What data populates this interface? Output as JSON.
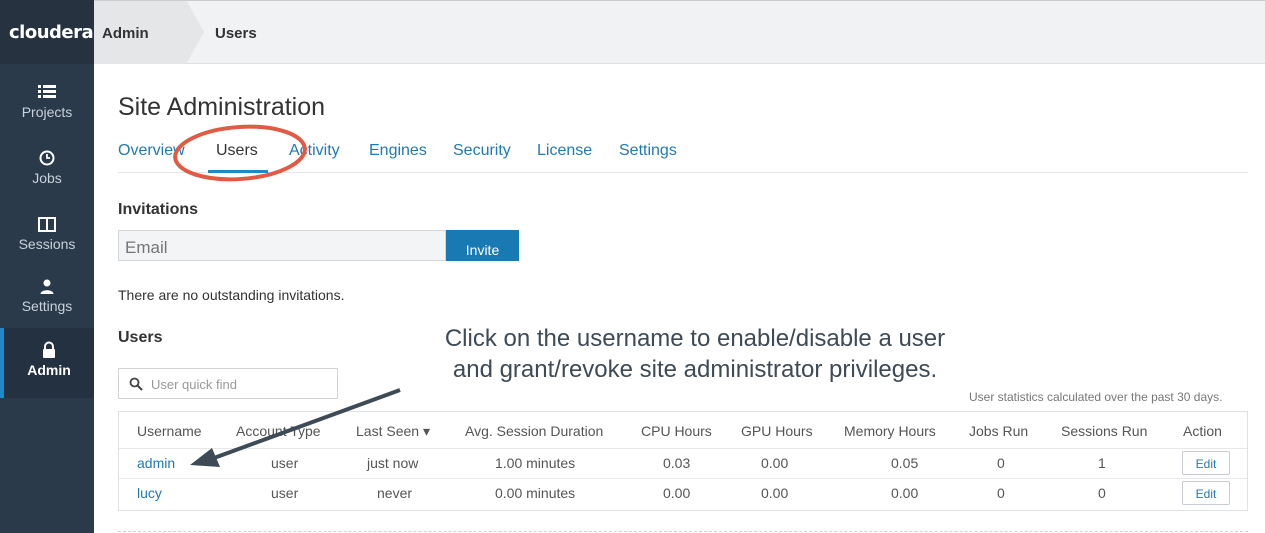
{
  "brand": {
    "logo_text": "cloudera"
  },
  "sidebar": {
    "items": [
      {
        "label": "Projects",
        "icon": "list-icon",
        "active": false
      },
      {
        "label": "Jobs",
        "icon": "clock-icon",
        "active": false
      },
      {
        "label": "Sessions",
        "icon": "columns-icon",
        "active": false
      },
      {
        "label": "Settings",
        "icon": "user-icon",
        "active": false
      },
      {
        "label": "Admin",
        "icon": "lock-icon",
        "active": true
      }
    ]
  },
  "breadcrumb": {
    "items": [
      "Admin",
      "Users"
    ]
  },
  "page": {
    "title": "Site Administration",
    "tabs": [
      "Overview",
      "Users",
      "Activity",
      "Engines",
      "Security",
      "License",
      "Settings"
    ],
    "active_tab": "Users"
  },
  "invitations": {
    "heading": "Invitations",
    "email_placeholder": "Email",
    "invite_label": "Invite",
    "empty_message": "There are no outstanding invitations."
  },
  "users": {
    "heading": "Users",
    "search_placeholder": "User quick find",
    "stats_note": "User statistics calculated over the past 30 days.",
    "columns": [
      "Username",
      "Account Type",
      "Last Seen",
      "Avg. Session Duration",
      "CPU Hours",
      "GPU Hours",
      "Memory Hours",
      "Jobs Run",
      "Sessions Run",
      "Action"
    ],
    "sort_indicator": "▾",
    "rows": [
      [
        "admin",
        "user",
        "just now",
        "1.00 minutes",
        "0.03",
        "0.00",
        "0.05",
        "0",
        "1",
        "Edit"
      ],
      [
        "lucy",
        "user",
        "never",
        "0.00 minutes",
        "0.00",
        "0.00",
        "0.00",
        "0",
        "0",
        "Edit"
      ]
    ]
  },
  "annotation": {
    "line1": "Click on the username to enable/disable a user",
    "line2": "and grant/revoke site administrator privileges."
  },
  "colors": {
    "sidebar_bg": "#2b3a4a",
    "accent": "#1e88c8",
    "link": "#1f7ab3",
    "highlight_circle": "#e05a44"
  }
}
